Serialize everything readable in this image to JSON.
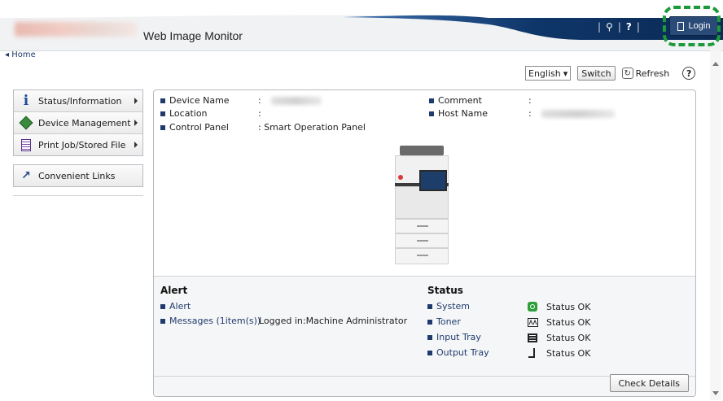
{
  "header": {
    "app_title": "Web Image Monitor",
    "search_glyph": "Q",
    "help_glyph": "?",
    "login_label": "Login",
    "home_link": "◂ Home"
  },
  "toolbar": {
    "language": "English",
    "switch_label": "Switch",
    "refresh_label": "Refresh",
    "help_glyph": "?"
  },
  "sidebar": {
    "items": [
      {
        "label": "Status/Information",
        "icon": "info-icon"
      },
      {
        "label": "Device Management",
        "icon": "device-management-icon"
      },
      {
        "label": "Print Job/Stored File",
        "icon": "document-icon"
      }
    ],
    "links": {
      "label": "Convenient Links",
      "icon": "link-arrow-icon"
    }
  },
  "device_info": {
    "device_name_label": "Device Name",
    "location_label": "Location",
    "control_panel_label": "Control Panel",
    "control_panel_value": ": Smart Operation Panel",
    "comment_label": "Comment",
    "host_name_label": "Host Name",
    "colon": ":"
  },
  "alert": {
    "title": "Alert",
    "alert_link": "Alert",
    "messages_link": "Messages (1item(s))",
    "logged_in": "Logged in:Machine Administrator"
  },
  "status": {
    "title": "Status",
    "rows": [
      {
        "name": "System",
        "value": "Status OK",
        "icon": "system-status-icon"
      },
      {
        "name": "Toner",
        "value": "Status OK",
        "icon": "toner-icon"
      },
      {
        "name": "Input Tray",
        "value": "Status OK",
        "icon": "input-tray-icon"
      },
      {
        "name": "Output Tray",
        "value": "Status OK",
        "icon": "output-tray-icon"
      }
    ],
    "check_details": "Check Details"
  },
  "colors": {
    "banner_dark": "#0d2e5c",
    "accent_green": "#1c9a3a",
    "link_blue": "#1f3b6e"
  }
}
